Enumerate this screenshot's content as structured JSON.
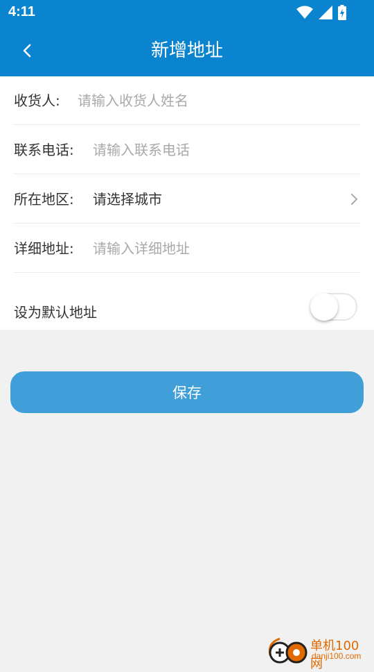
{
  "status_bar": {
    "time": "4:11",
    "icons": [
      "wifi-icon",
      "signal-icon",
      "battery-charging-icon"
    ]
  },
  "header": {
    "title": "新增地址",
    "back_icon": "back-arrow-icon"
  },
  "form": {
    "receiver": {
      "label": "收货人:",
      "placeholder": "请输入收货人姓名",
      "value": ""
    },
    "phone": {
      "label": "联系电话:",
      "placeholder": "请输入联系电话",
      "value": ""
    },
    "region": {
      "label": "所在地区:",
      "value": "请选择城市",
      "icon": "chevron-right-icon"
    },
    "detail": {
      "label": "详细地址:",
      "placeholder": "请输入详细地址",
      "value": ""
    },
    "default_address": {
      "label": "设为默认地址",
      "enabled": false
    }
  },
  "actions": {
    "save_label": "保存"
  },
  "watermark": {
    "name": "单机100网",
    "url": "danji100.com"
  },
  "colors": {
    "header_bg": "#0a84cf",
    "save_button_bg": "#409fd8",
    "page_bg": "#f1f1f1",
    "placeholder": "#a9a9a9",
    "watermark": "#e06a00"
  }
}
